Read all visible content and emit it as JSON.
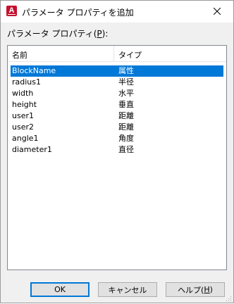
{
  "window": {
    "title": "パラメータ プロパティを追加",
    "icon_letter": "A",
    "icon_color": "#c4122f"
  },
  "list": {
    "label_prefix": "パラメータ プロパティ(",
    "label_accel": "P",
    "label_suffix": "):",
    "columns": [
      "名前",
      "タイプ"
    ],
    "selected_color": "#0078d7",
    "rows": [
      {
        "name": "BlockName",
        "type": "属性",
        "selected": true
      },
      {
        "name": "radius1",
        "type": "半径"
      },
      {
        "name": "width",
        "type": "水平"
      },
      {
        "name": "height",
        "type": "垂直"
      },
      {
        "name": "user1",
        "type": "距離"
      },
      {
        "name": "user2",
        "type": "距離"
      },
      {
        "name": "angle1",
        "type": "角度"
      },
      {
        "name": "diameter1",
        "type": "直径"
      }
    ]
  },
  "buttons": {
    "ok": "OK",
    "cancel": "キャンセル",
    "help_prefix": "ヘルプ(",
    "help_accel": "H",
    "help_suffix": ")"
  },
  "icons": {
    "close": "close-icon",
    "app": "autocad-app-icon",
    "grip": "resize-grip-icon"
  }
}
